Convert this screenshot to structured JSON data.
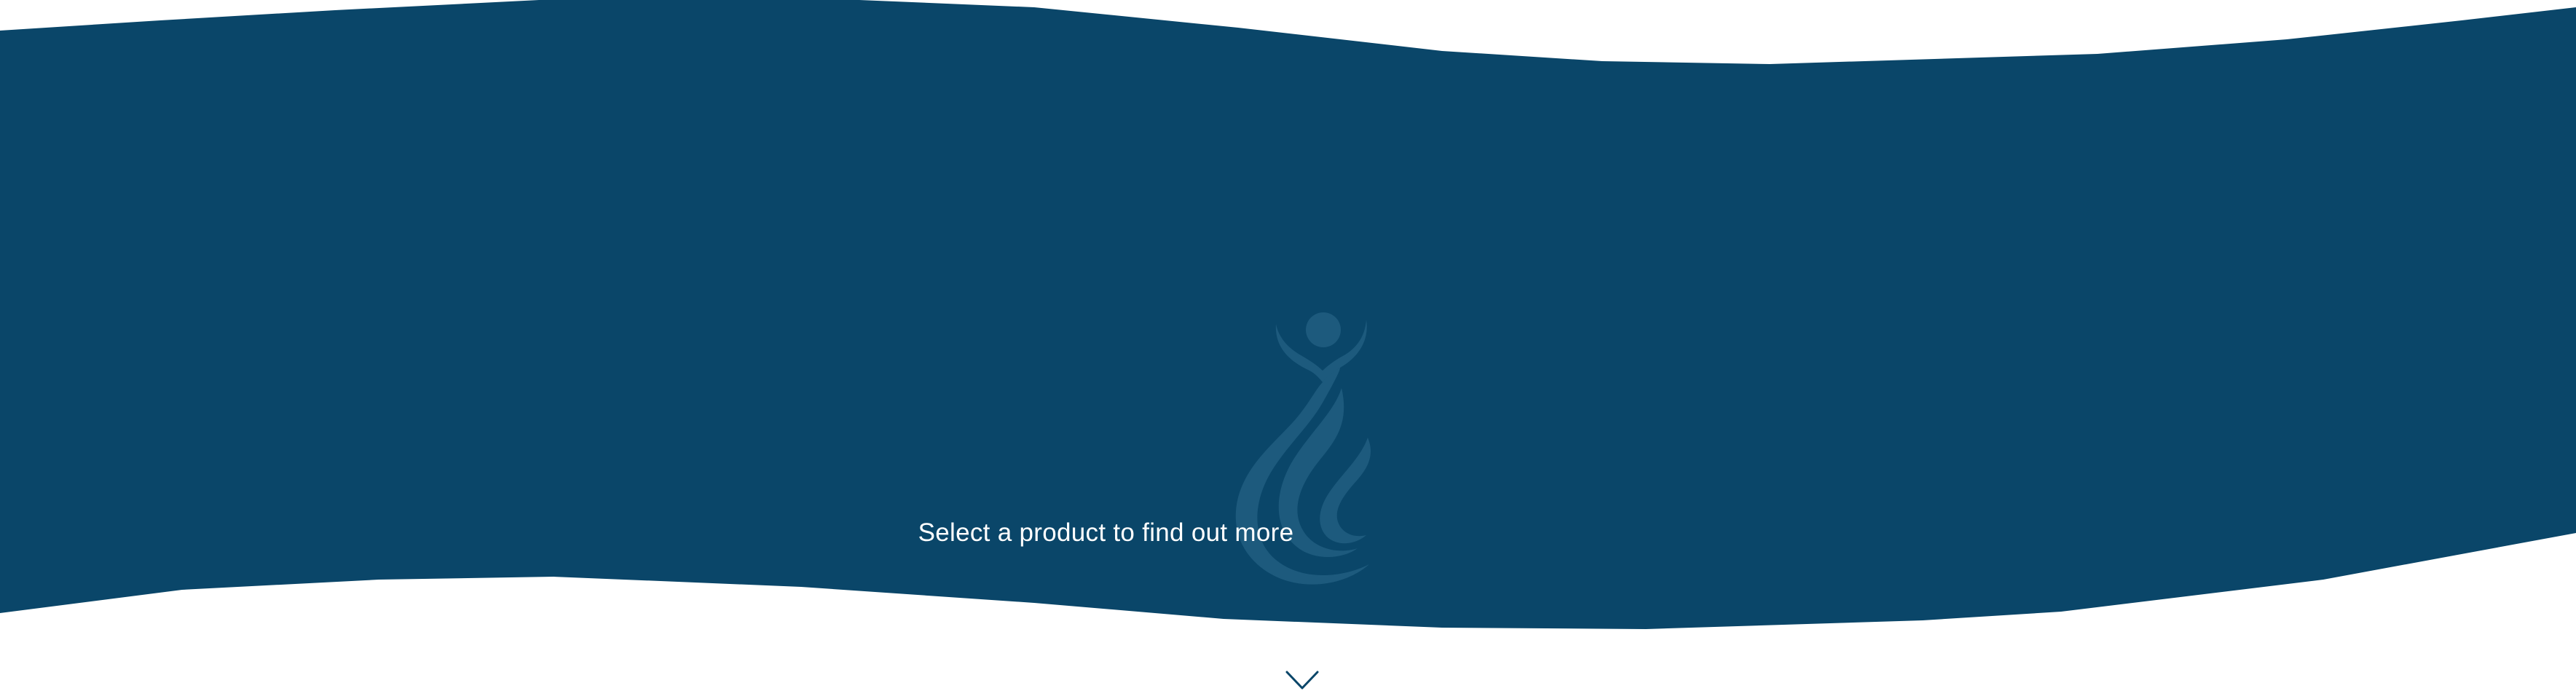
{
  "hero": {
    "tagline": "Select a product to find out more",
    "background_color": "#0a4669",
    "text_color": "#ffffff",
    "watermark_color": "#1d5a7d",
    "page_background": "#ffffff"
  },
  "icons": {
    "watermark": "flame-figure-logo-icon",
    "scroll": "chevron-down-icon"
  },
  "scroll_indicator": {
    "color": "#0a4669"
  }
}
